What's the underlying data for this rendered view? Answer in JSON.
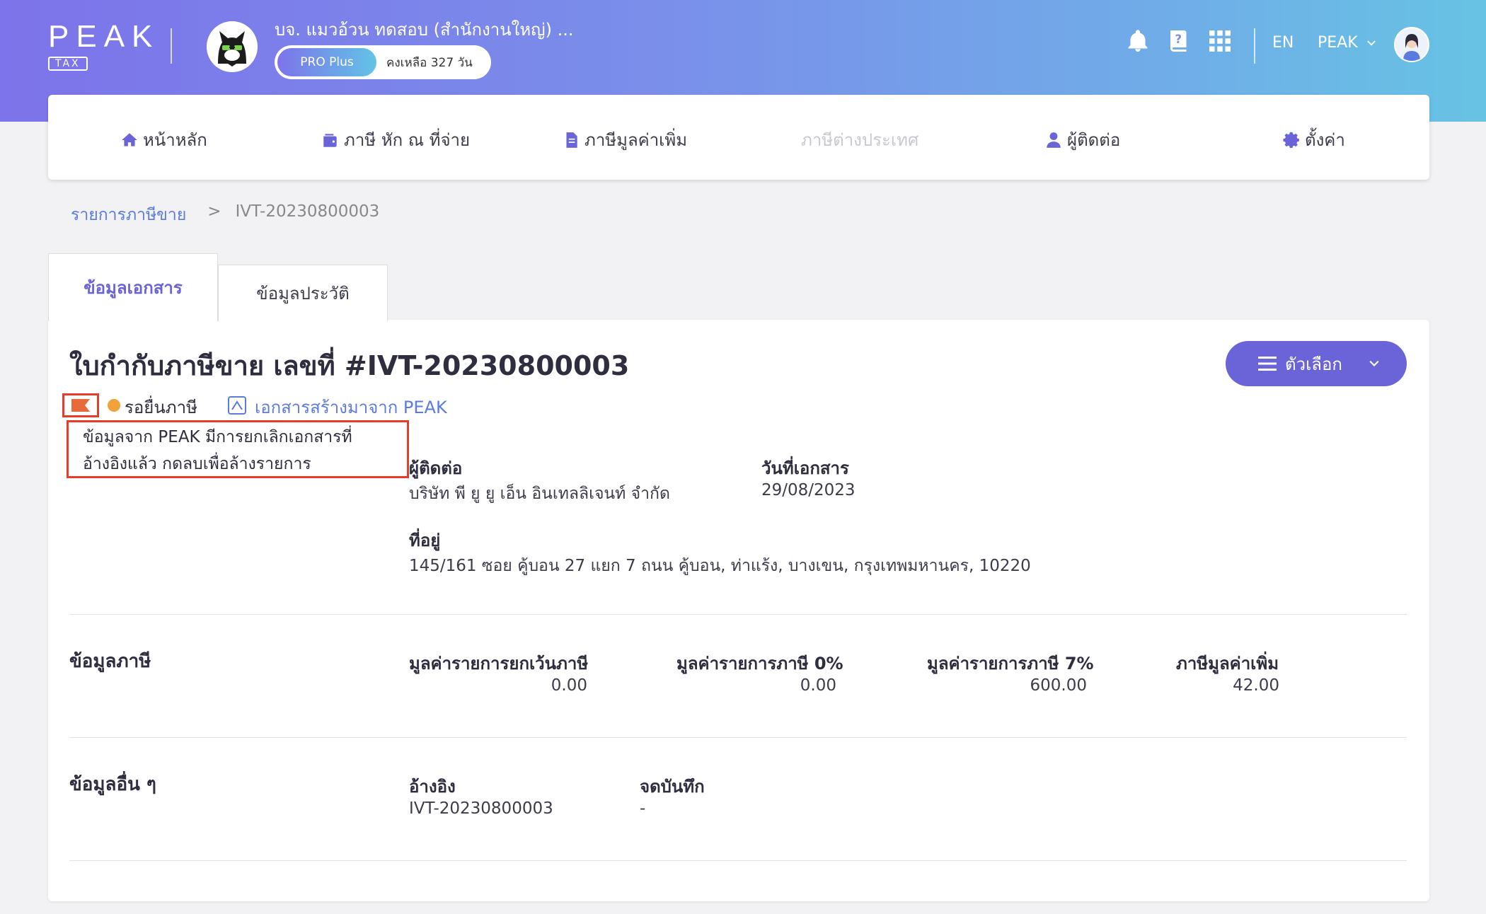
{
  "header": {
    "logo_text": "PEAK",
    "logo_sub": "TAX",
    "company_name": "บจ. แมวอ้วน ทดสอบ (สำนักงานใหญ่) ...",
    "plan_label": "PRO Plus",
    "plan_remaining": "คงเหลือ 327 วัน",
    "language": "EN",
    "user_name": "PEAK"
  },
  "nav": {
    "home": "หน้าหลัก",
    "withholding": "ภาษี หัก ณ ที่จ่าย",
    "vat": "ภาษีมูลค่าเพิ่ม",
    "foreign_tax": "ภาษีต่างประเทศ",
    "contacts": "ผู้ติดต่อ",
    "settings": "ตั้งค่า"
  },
  "breadcrumb": {
    "parent": "รายการภาษีขาย",
    "separator": ">",
    "current": "IVT-20230800003"
  },
  "tabs": {
    "document_info": "ข้อมูลเอกสาร",
    "history": "ข้อมูลประวัติ"
  },
  "document": {
    "title": "ใบกำกับภาษีขาย เลขที่ #IVT-20230800003",
    "options_label": "ตัวเลือก",
    "status": "รอยื่นภาษี",
    "status_color": "#f0a33c",
    "source": "เอกสารสร้างมาจาก PEAK",
    "note_line1": "ข้อมูลจาก PEAK มีการยกเลิกเอกสารที่",
    "note_line2": "อ้างอิงแล้ว กดลบเพื่อล้างรายการ",
    "contact_label": "ผู้ติดต่อ",
    "contact_value": "บริษัท พี ยู ยู เอ็น อินเทลลิเจนท์ จำกัด",
    "doc_date_label": "วันที่เอกสาร",
    "doc_date_value": "29/08/2023",
    "address_label": "ที่อยู่",
    "address_value": "145/161 ซอย คู้บอน 27 แยก 7 ถนน คู้บอน, ท่าแร้ง, บางเขน, กรุงเทพมหานคร, 10220"
  },
  "tax_info": {
    "section_title": "ข้อมูลภาษี",
    "exempt_label": "มูลค่ารายการยกเว้นภาษี",
    "exempt_value": "0.00",
    "zero_label": "มูลค่ารายการภาษี 0%",
    "zero_value": "0.00",
    "seven_label": "มูลค่ารายการภาษี 7%",
    "seven_value": "600.00",
    "vat_label": "ภาษีมูลค่าเพิ่ม",
    "vat_value": "42.00"
  },
  "other_info": {
    "section_title": "ข้อมูลอื่น ๆ",
    "reference_label": "อ้างอิง",
    "reference_value": "IVT-20230800003",
    "memo_label": "จดบันทึก",
    "memo_value": "-"
  },
  "colors": {
    "accent": "#6b63d8",
    "link": "#5b7be0",
    "highlight_box": "#e53d2a"
  }
}
